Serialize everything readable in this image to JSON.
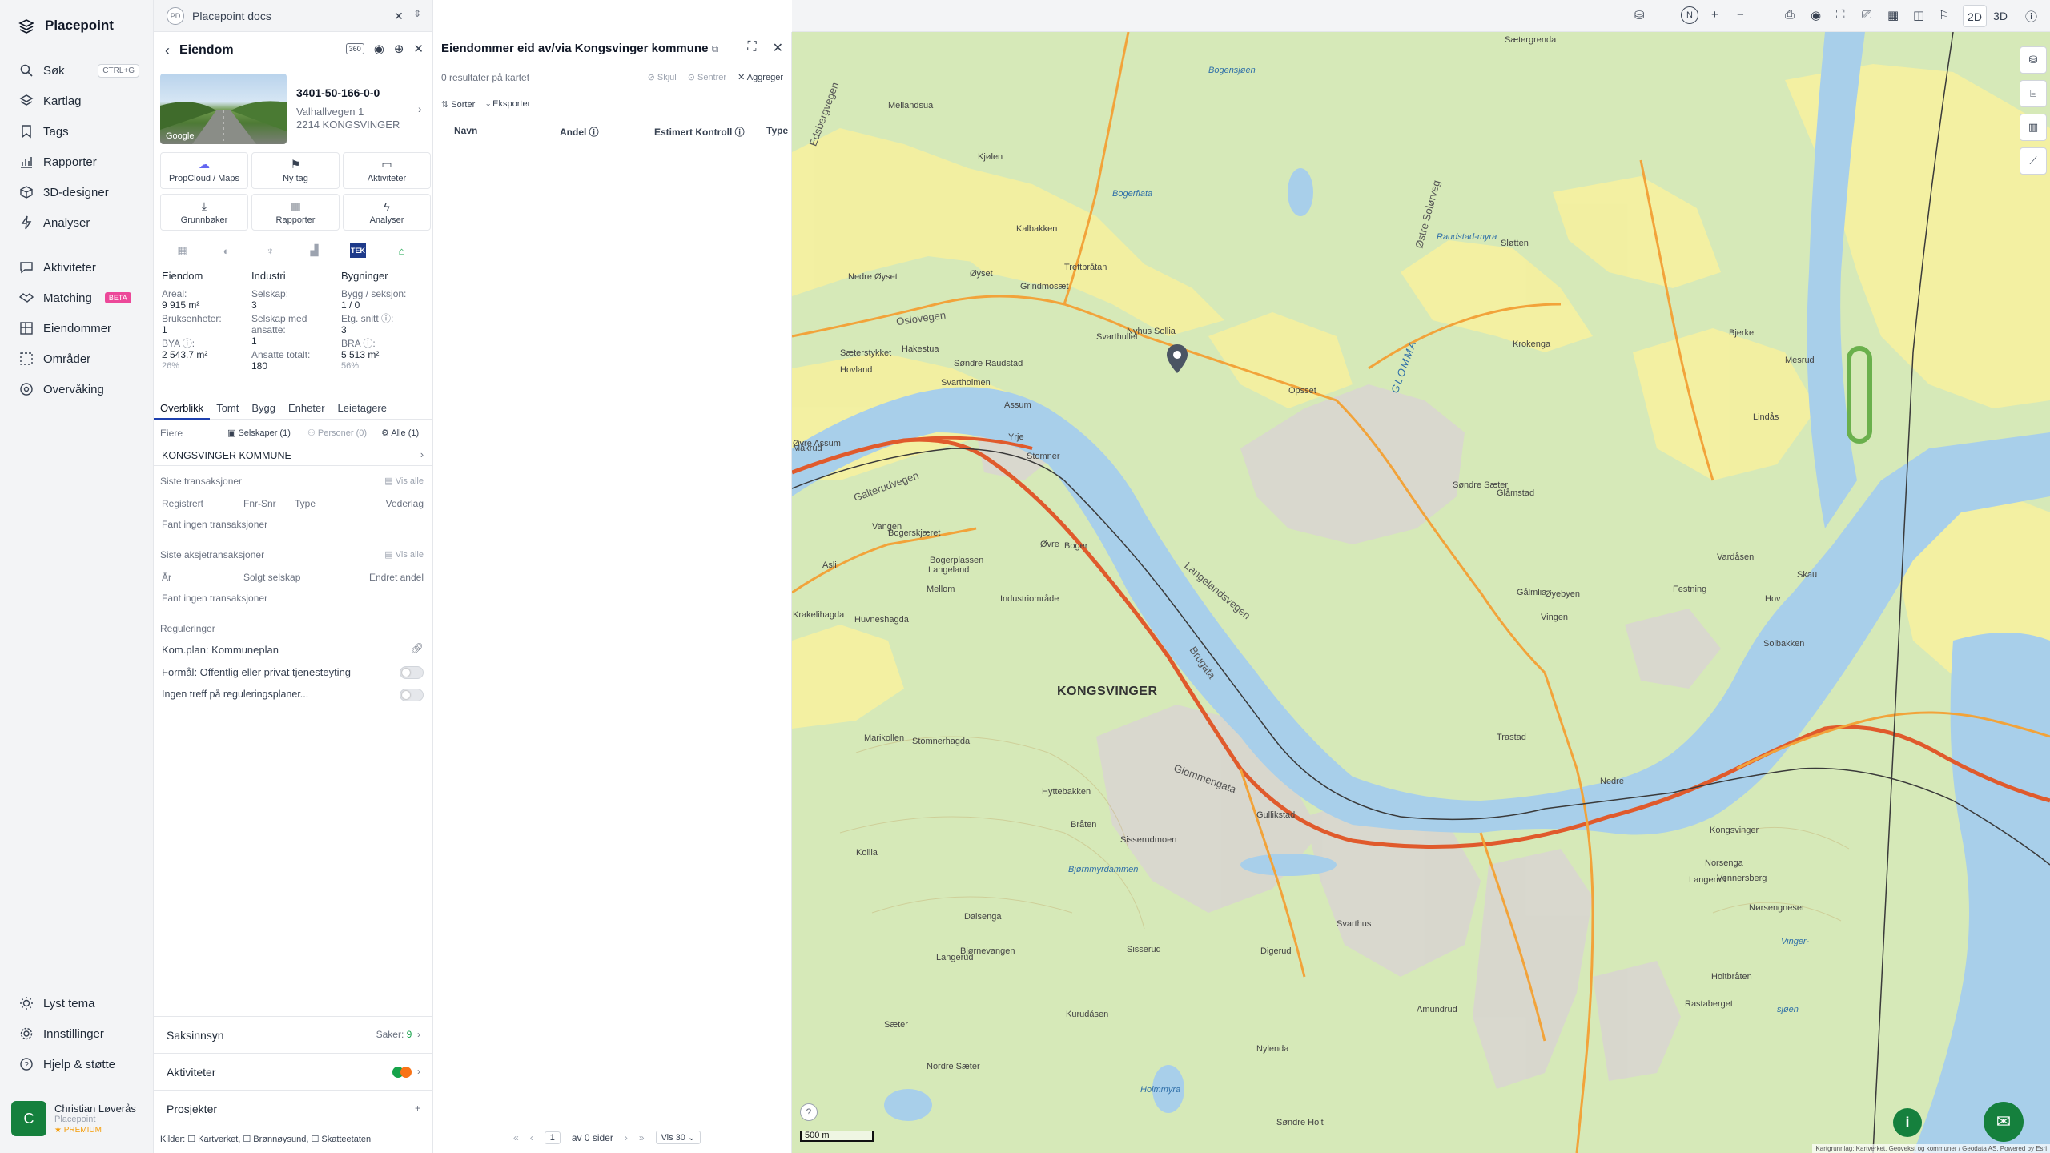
{
  "app": {
    "name": "Placepoint"
  },
  "nav": {
    "items": [
      {
        "label": "Søk",
        "shortcut": "CTRL+G",
        "icon": "search-icon"
      },
      {
        "label": "Kartlag",
        "icon": "layers-icon"
      },
      {
        "label": "Tags",
        "icon": "bookmark-icon"
      },
      {
        "label": "Rapporter",
        "icon": "chart-icon"
      },
      {
        "label": "3D-designer",
        "icon": "cube-icon"
      },
      {
        "label": "Analyser",
        "icon": "bolt-icon"
      },
      {
        "label": "Aktiviteter",
        "icon": "activity-icon"
      },
      {
        "label": "Matching",
        "badge": "BETA",
        "icon": "handshake-icon"
      },
      {
        "label": "Eiendommer",
        "icon": "grid-icon"
      },
      {
        "label": "Områder",
        "icon": "area-icon"
      },
      {
        "label": "Overvåking",
        "icon": "radar-icon"
      }
    ],
    "bottom": [
      {
        "label": "Lyst tema",
        "icon": "sun-icon"
      },
      {
        "label": "Innstillinger",
        "icon": "gear-icon"
      },
      {
        "label": "Hjelp & støtte",
        "icon": "help-icon"
      }
    ],
    "user": {
      "initial": "C",
      "name": "Christian Løverås",
      "org": "Placepoint",
      "plan": "PREMIUM"
    }
  },
  "workspace": {
    "badge": "PD",
    "name": "Placepoint docs"
  },
  "property": {
    "header": "Eiendom",
    "badge_360": "360",
    "photo_credit": "Google",
    "id": "3401-50-166-0-0",
    "address1": "Valhallvegen 1",
    "address2": "2214 KONGSVINGER",
    "actions": [
      {
        "label": "PropCloud / Maps",
        "icon": "cloud-icon"
      },
      {
        "label": "Ny tag",
        "icon": "bookmark-icon"
      },
      {
        "label": "Aktiviteter",
        "icon": "message-icon"
      },
      {
        "label": "Grunnbøker",
        "icon": "download-icon"
      },
      {
        "label": "Rapporter",
        "icon": "chart-icon"
      },
      {
        "label": "Analyser",
        "icon": "bolt-icon"
      }
    ],
    "source_tek": "TEK",
    "stats": {
      "eiendom": {
        "title": "Eiendom",
        "rows": [
          {
            "k": "Areal:",
            "v": "9 915 m²"
          },
          {
            "k": "Bruksenheter:",
            "v": "1"
          },
          {
            "k": "BYA ⓘ:",
            "v": "2 543.7 m²",
            "pct": "26%"
          }
        ]
      },
      "industri": {
        "title": "Industri",
        "rows": [
          {
            "k": "Selskap:",
            "v": "3"
          },
          {
            "k": "Selskap med ansatte:",
            "v": "1"
          },
          {
            "k": "Ansatte totalt:",
            "v": "180"
          }
        ]
      },
      "bygninger": {
        "title": "Bygninger",
        "rows": [
          {
            "k": "Bygg / seksjon:",
            "v": "1 / 0"
          },
          {
            "k": "Etg. snitt ⓘ:",
            "v": "3"
          },
          {
            "k": "BRA ⓘ:",
            "v": "5 513 m²",
            "pct": "56%"
          }
        ]
      }
    },
    "tabs": [
      "Overblikk",
      "Tomt",
      "Bygg",
      "Enheter",
      "Leietagere"
    ],
    "owners": {
      "label": "Eiere",
      "f_selskaper": "Selskaper (1)",
      "f_personer": "Personer (0)",
      "f_alle": "Alle (1)",
      "owner": "KONGSVINGER KOMMUNE"
    },
    "transactions": {
      "title": "Siste transaksjoner",
      "see_all": "Vis alle",
      "cols": [
        "Registrert",
        "Fnr-Snr",
        "Type",
        "Vederlag"
      ],
      "empty": "Fant ingen transaksjoner"
    },
    "share_tx": {
      "title": "Siste aksjetransaksjoner",
      "see_all": "Vis alle",
      "cols": [
        "År",
        "Solgt selskap",
        "Endret andel"
      ],
      "empty": "Fant ingen transaksjoner"
    },
    "regulations": {
      "title": "Reguleringer",
      "plan": "Kom.plan: Kommuneplan",
      "purpose": "Formål: Offentlig eller privat tjenesteyting",
      "none": "Ingen treff på reguleringsplaner..."
    },
    "saksinnsyn": {
      "label": "Saksinnsyn",
      "count_label": "Saker:",
      "count": "9"
    },
    "aktiviteter": {
      "label": "Aktiviteter"
    },
    "prosjekter": {
      "label": "Prosjekter",
      "add": "+"
    },
    "kilder": "Kilder: ☐ Kartverket, ☐ Brønnøysund, ☐ Skatteetaten"
  },
  "owned": {
    "title": "Eiendommer eid av/via Kongsvinger kommune",
    "results": "0 resultater på kartet",
    "skjul": "Skjul",
    "sentrer": "Sentrer",
    "aggreger": "Aggreger",
    "sort": "Sorter",
    "export": "Eksporter",
    "columns": [
      "Navn",
      "Andel ⓘ",
      "Estimert Kontroll ⓘ",
      "Type"
    ],
    "pager": {
      "page": "1",
      "of": "av 0 sider",
      "per_page": "Vis 30"
    }
  },
  "toolbar": {
    "view2d": "2D",
    "view3d": "3D",
    "compass": "N"
  },
  "map": {
    "scale": "500 m",
    "attribution": "Kartgrunnlag: Kartverket, Geovekst og kommuner / Geodata AS, Powered by Esri",
    "labels": {
      "town": "KONGSVINGER",
      "glomma": "GLOMMA",
      "oslovegen": "Oslovegen",
      "galterudvegen": "Galterudvegen",
      "glommengata": "Glommengata",
      "brugata": "Brugata",
      "langelandsvegen": "Langelandsvegen",
      "bjornmyrdammen": "Bjørnmyrdammen",
      "bogerflata": "Bogerflata",
      "raudstadmyra": "Raudstad-myra",
      "holmmyra": "Holmmyra",
      "sjoen": "sjøen",
      "vinger": "Vinger-",
      "edsbergvegen": "Edsbergvegen",
      "bogensjoen": "Bogensjøen",
      "ostre_solorveg": "Østre Solørveg",
      "places": [
        "Sætergrenda",
        "Mellandsua",
        "Kjølen",
        "Kalbakken",
        "Nedre Øyset",
        "Øyset",
        "Grindmosæt",
        "Trettbråtan",
        "Hakestua",
        "Nyhus",
        "Sollia",
        "Hovland",
        "Svartholmen",
        "Assum",
        "Yrje",
        "Stomner",
        "Øvre Assum",
        "Måkrud",
        "Øvre",
        "Asli",
        "Bogerplassen",
        "Mellom",
        "Krakelihagda",
        "Huvneshagda",
        "Marikollen",
        "Stomnerhagda",
        "Kollia",
        "Daisenga",
        "Bjørnevangen",
        "Sæter",
        "Nordre Sæter",
        "Krokenga",
        "Sløtten",
        "Bjerke",
        "Mesrud",
        "Lindås",
        "Skau",
        "Hov",
        "Solbakken",
        "Vardåsen",
        "Opsset",
        "Søndre Sæter",
        "Glåmstad",
        "Gålmlia",
        "Festning",
        "Øyebyen",
        "Vingen",
        "Trastad",
        "Kongsvinger",
        "Norsenga",
        "Vennersberg",
        "Langerud",
        "Nørsengneset",
        "Holtbråten",
        "Rastaberget",
        "Amundrud",
        "Nylenda",
        "Søndre Holt",
        "Kurudåsen",
        "Svarthus",
        "Digerud",
        "Hyttebakken",
        "Bråten",
        "Nedre",
        "Gullikstad",
        "Sisserud",
        "Sisserudmoen",
        "Industriområde",
        "Langeland",
        "Boger",
        "Vangen",
        "Bogerskjæret",
        "Søndre Raudstad",
        "Sæterstykket",
        "Svarthullet",
        "Langerud"
      ]
    }
  }
}
